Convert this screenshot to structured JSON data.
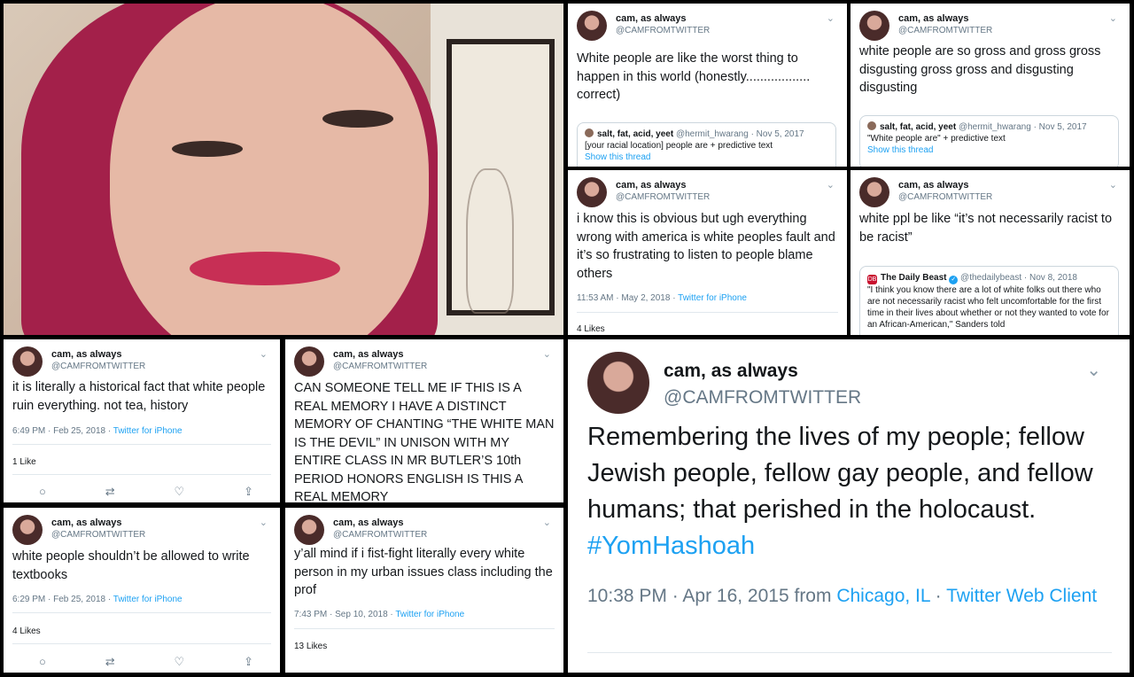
{
  "photo": {
    "alt": "selfie"
  },
  "tweets": {
    "t1": {
      "name": "cam, as always",
      "handle": "@CAMFROMTWITTER",
      "text": "White people are like the worst thing to happen in this world (honestly.................. correct)",
      "quote": {
        "name": "salt, fat, acid, yeet",
        "handle": "@hermit_hwarang · Nov 5, 2017",
        "text": "[your racial location] people are + predictive text",
        "show": "Show this thread"
      }
    },
    "t2": {
      "name": "cam, as always",
      "handle": "@CAMFROMTWITTER",
      "text": "white people are so gross and gross gross disgusting gross gross and disgusting disgusting",
      "quote": {
        "name": "salt, fat, acid, yeet",
        "handle": "@hermit_hwarang · Nov 5, 2017",
        "text": "\"White people are\" + predictive text",
        "show": "Show this thread"
      }
    },
    "t3": {
      "name": "cam, as always",
      "handle": "@CAMFROMTWITTER",
      "text": "i know this is obvious but ugh everything wrong with america is white peoples fault and it’s so frustrating to listen to people blame others",
      "time": "11:53 AM · May 2, 2018 · ",
      "client": "Twitter for iPhone",
      "likes": "4 Likes"
    },
    "t4": {
      "name": "cam, as always",
      "handle": "@CAMFROMTWITTER",
      "text": "white ppl be like “it’s not necessarily racist to be racist”",
      "quote": {
        "name": "The Daily Beast",
        "handle": "@thedailybeast · Nov 8, 2018",
        "text": "\"I think you know there are a lot of white folks out there who are not necessarily racist who felt uncomfortable for the first time in their lives about whether or not they wanted to vote for an African-American,\" Sanders told"
      }
    },
    "t5": {
      "name": "cam, as always",
      "handle": "@CAMFROMTWITTER",
      "text": "it is literally a historical fact that white people ruin everything. not tea, history",
      "time": "6:49 PM · Feb 25, 2018 · ",
      "client": "Twitter for iPhone",
      "likes": "1 Like"
    },
    "t6": {
      "name": "cam, as always",
      "handle": "@CAMFROMTWITTER",
      "text": "CAN SOMEONE TELL ME IF THIS IS A REAL MEMORY I HAVE A DISTINCT MEMORY OF CHANTING “THE WHITE MAN IS THE DEVIL” IN UNISON WITH MY ENTIRE CLASS IN MR BUTLER’S 10th PERIOD HONORS ENGLISH IS THIS A REAL MEMORY"
    },
    "t7": {
      "name": "cam, as always",
      "handle": "@CAMFROMTWITTER",
      "text": "white people shouldn’t be allowed to write textbooks",
      "time": "6:29 PM · Feb 25, 2018 · ",
      "client": "Twitter for iPhone",
      "likes": "4 Likes"
    },
    "t8": {
      "name": "cam, as always",
      "handle": "@CAMFROMTWITTER",
      "text": "y’all mind if i fist-fight literally every white person in my urban issues class including the prof",
      "time": "7:43 PM · Sep 10, 2018 · ",
      "client": "Twitter for iPhone",
      "likes": "13 Likes"
    },
    "t9": {
      "name": "cam, as always",
      "handle": "@CAMFROMTWITTER",
      "text": "Remembering the lives of my people; fellow Jewish people, fellow gay people, and fellow humans; that perished in the holocaust. ",
      "hashtag": "#YomHashoah",
      "time": "10:38 PM · Apr 16, 2015 from ",
      "location": "Chicago, IL",
      "sep": " · ",
      "client": "Twitter Web Client"
    }
  },
  "icons": {
    "chevron": "⌄",
    "reply": "○",
    "retweet": "⇄",
    "like": "♡",
    "share": "⇪"
  },
  "colors": {
    "link": "#1da1f2",
    "muted": "#657786",
    "text": "#14171a"
  }
}
